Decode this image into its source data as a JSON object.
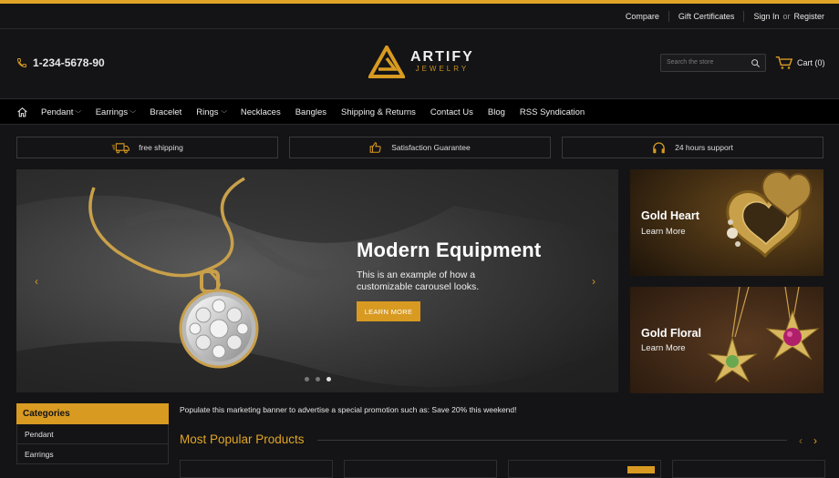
{
  "colors": {
    "accent": "#e0a526",
    "background": "#141416",
    "nav_bg": "#000000"
  },
  "topbar": {
    "compare": "Compare",
    "gift": "Gift Certificates",
    "signin": "Sign In",
    "or": "or",
    "register": "Register"
  },
  "header": {
    "phone": "1-234-5678-90",
    "brand": "ARTIFY",
    "brand_sub": "JEWELRY",
    "search_placeholder": "Search the store",
    "cart": "Cart (0)"
  },
  "nav": {
    "home_icon": "home-icon",
    "items": [
      {
        "label": "Pendant",
        "dropdown": true
      },
      {
        "label": "Earrings",
        "dropdown": true
      },
      {
        "label": "Bracelet",
        "dropdown": false
      },
      {
        "label": "Rings",
        "dropdown": true
      },
      {
        "label": "Necklaces",
        "dropdown": false
      },
      {
        "label": "Bangles",
        "dropdown": false
      },
      {
        "label": "Shipping & Returns",
        "dropdown": false
      },
      {
        "label": "Contact Us",
        "dropdown": false
      },
      {
        "label": "Blog",
        "dropdown": false
      },
      {
        "label": "RSS Syndication",
        "dropdown": false
      }
    ]
  },
  "features": [
    {
      "icon": "truck-icon",
      "label": "free shipping"
    },
    {
      "icon": "thumbs-up-icon",
      "label": "Satisfaction Guarantee"
    },
    {
      "icon": "headphones-icon",
      "label": "24 hours support"
    }
  ],
  "slider": {
    "title": "Modern Equipment",
    "description": "This is an example of how a customizable carousel looks.",
    "button": "LEARN MORE",
    "active_slide": 3,
    "slide_count": 3
  },
  "promos": [
    {
      "title": "Gold Heart",
      "link": "Learn More"
    },
    {
      "title": "Gold Floral",
      "link": "Learn More"
    }
  ],
  "categories": {
    "heading": "Categories",
    "items": [
      "Pendant",
      "Earrings"
    ]
  },
  "banner_text": "Populate this marketing banner to advertise a special promotion such as: Save 20% this weekend!",
  "popular": {
    "heading": "Most Popular Products"
  }
}
